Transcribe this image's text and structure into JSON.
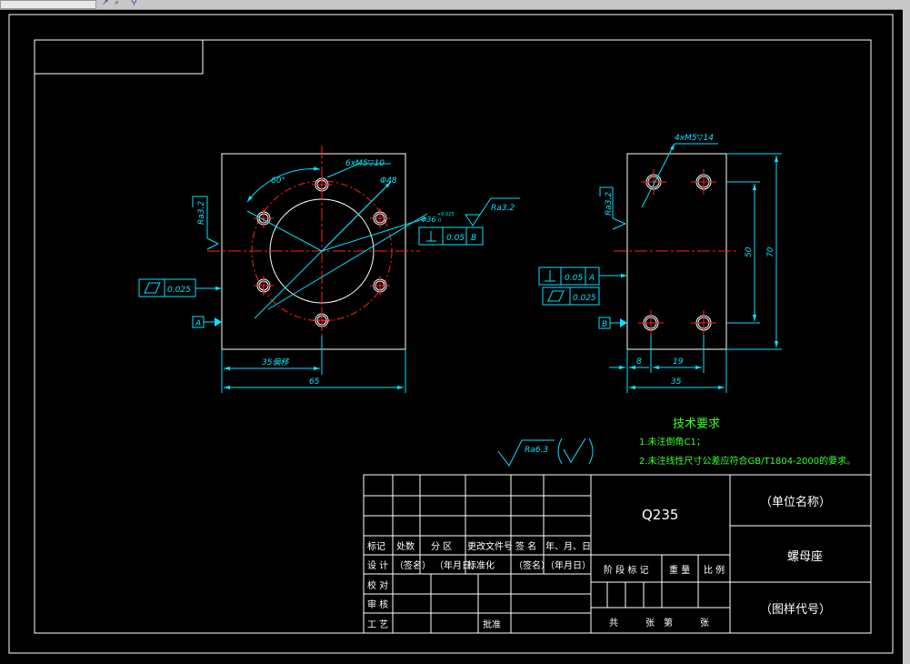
{
  "drawing": {
    "front_view": {
      "thread_callout": "6xM5▽10",
      "angle": "60°",
      "pcd_label": "Φ48",
      "bore_label": "Φ36",
      "bore_tolerance": "+0.025",
      "bore_tolerance_low": "0",
      "roughness_left": "Ra3.2",
      "roughness_right": "Ra3.2",
      "perp_value": "0.05",
      "perp_datum": "B",
      "flatness_value": "0.025",
      "datum": "A",
      "dim_half": "35偏移",
      "dim_width": "65"
    },
    "side_view": {
      "thread_callout": "4xM5▽14",
      "roughness": "Ra3.2",
      "perp_value": "0.05",
      "perp_datum": "A",
      "flatness_value": "0.025",
      "datum": "B",
      "dim_hole_spacing": "50",
      "dim_height": "70",
      "dim_edge": "8",
      "dim_pitch": "19",
      "dim_width": "35"
    },
    "general_roughness": "Ra6.3",
    "tech_requirements": {
      "title": "技术要求",
      "item1": "1.未注倒角C1；",
      "item2": "2.未注线性尺寸公差应符合GB/T1804-2000的要求。"
    },
    "title_block": {
      "material": "Q235",
      "company": "（单位名称）",
      "part_name": "螺母座",
      "drawing_number": "（图样代号）",
      "rev_headers": [
        "标记",
        "处数",
        "分 区",
        "更改文件号",
        "签 名",
        "年、月、日"
      ],
      "row_design": [
        "设 计",
        "（签名）",
        "（年月日）",
        "标准化",
        "（签名）",
        "（年月日）"
      ],
      "row_check": "校 对",
      "row_review": "审 核",
      "row_process": "工 艺",
      "approve": "批准",
      "stage_mark": "阶 段 标 记",
      "weight": "重 量",
      "scale": "比 例",
      "sheets": [
        "共",
        "张",
        "第",
        "张"
      ]
    }
  },
  "colors": {
    "background": "#000000",
    "line": "#ffffff",
    "dimension": "#00e5ff",
    "center": "#ff2020",
    "note": "#39ff2e"
  }
}
